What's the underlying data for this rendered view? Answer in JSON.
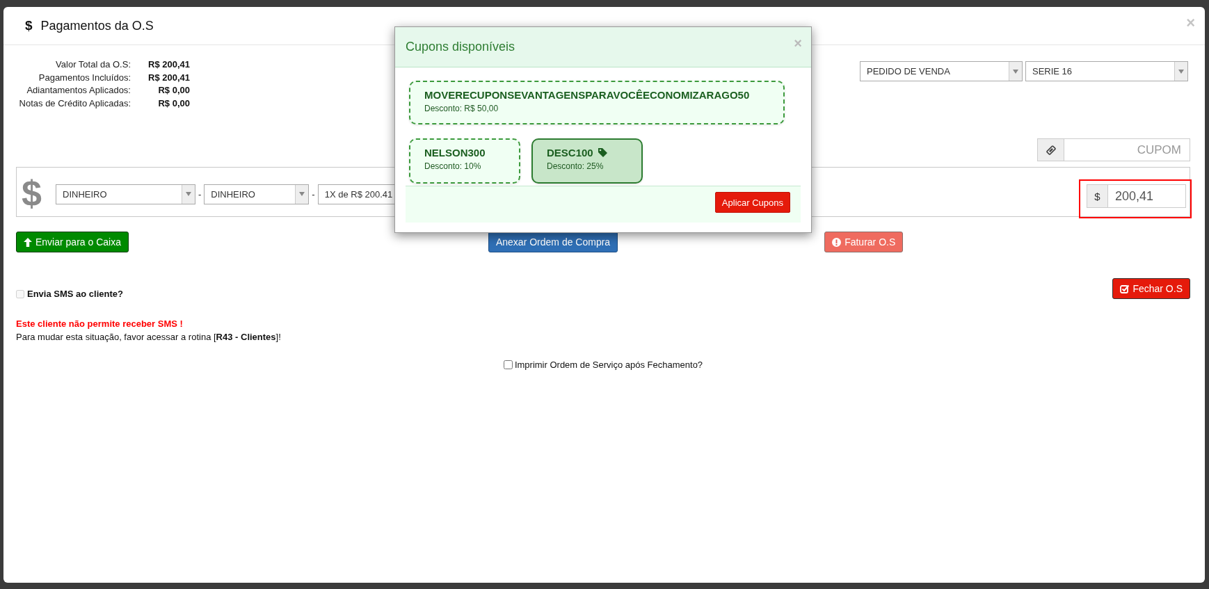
{
  "modal": {
    "icon": "$",
    "title": "Pagamentos da O.S",
    "close": "×"
  },
  "summary": [
    {
      "label": "Valor Total da O.S:",
      "value": "R$ 200,41"
    },
    {
      "label": "Pagamentos Incluídos:",
      "value": "R$ 200,41"
    },
    {
      "label": "Adiantamentos Aplicados:",
      "value": "R$ 0,00"
    },
    {
      "label": "Notas de Crédito Aplicadas:",
      "value": "R$ 0,00"
    }
  ],
  "document_type": {
    "value": "PEDIDO DE VENDA"
  },
  "series": {
    "value": "SERIE 16"
  },
  "coupon_field": {
    "placeholder": "CUPOM"
  },
  "payment": {
    "symbol": "$",
    "method": "DINHEIRO",
    "separators": [
      "-",
      "-"
    ],
    "submethod": "DINHEIRO",
    "installments": "1X de R$ 200.41",
    "currency": "$",
    "amount": "200,41",
    "highlighted": true
  },
  "send_button": {
    "label": "Enviar para o Caixa"
  },
  "attach_button": {
    "label": "Anexar Ordem de Compra"
  },
  "invoice_button": {
    "label": "Faturar O.S",
    "disabled": true
  },
  "close_button": {
    "label": "Fechar O.S"
  },
  "sms_option": {
    "label": "Envia SMS ao cliente?",
    "checked": false,
    "disabled": true
  },
  "sms_warning": "Este cliente não permite receber SMS !",
  "sms_info": "Para mudar esta situação, favor acessar a rotina [**R43 - Clientes**]!",
  "print_option": {
    "label": "Imprimir Ordem de Serviço após Fechamento?",
    "checked": false
  },
  "coupons_dialog": {
    "title": "Cupons disponíveis",
    "close": "×",
    "apply_button": "Aplicar Cupons",
    "coupons": [
      {
        "code": "MOVERECUPONSEVANTAGENSPARAVOCÊECONOMIZARAGO50",
        "discount": "Desconto: R$ 50,00",
        "selected": false
      },
      {
        "code": "NELSON300",
        "discount": "Desconto: 10%",
        "selected": false
      },
      {
        "code": "DESC100",
        "discount": "Desconto: 25%",
        "selected": true
      }
    ]
  }
}
